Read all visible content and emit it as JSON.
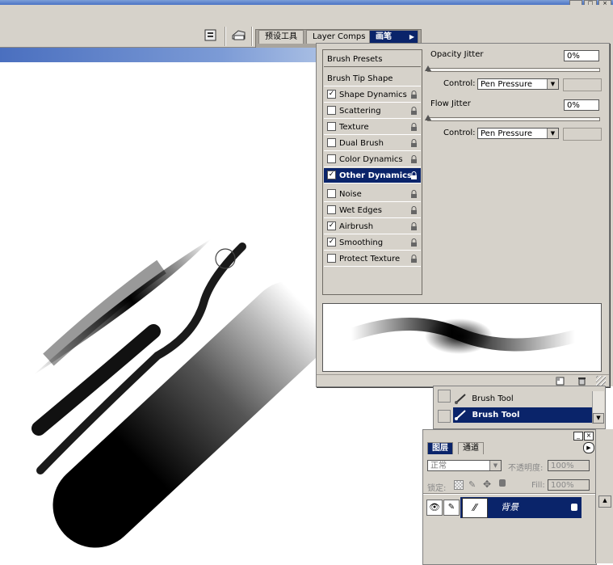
{
  "window": {
    "controls": [
      "_",
      "□",
      "×"
    ]
  },
  "toolbar": {
    "tabs": [
      {
        "label": "预设工具",
        "active": false
      },
      {
        "label": "Layer Comps",
        "active": false
      },
      {
        "label": "画笔",
        "active": true
      }
    ]
  },
  "brush_panel": {
    "presets_label": "Brush Presets",
    "tip_shape_label": "Brush Tip Shape",
    "items": [
      {
        "label": "Shape Dynamics",
        "checked": true
      },
      {
        "label": "Scattering",
        "checked": false
      },
      {
        "label": "Texture",
        "checked": false
      },
      {
        "label": "Dual Brush",
        "checked": false
      },
      {
        "label": "Color Dynamics",
        "checked": false
      },
      {
        "label": "Other Dynamics",
        "checked": true,
        "selected": true
      },
      {
        "label": "Noise",
        "checked": false
      },
      {
        "label": "Wet Edges",
        "checked": false
      },
      {
        "label": "Airbrush",
        "checked": true
      },
      {
        "label": "Smoothing",
        "checked": true
      },
      {
        "label": "Protect Texture",
        "checked": false
      }
    ],
    "opacity_jitter": {
      "label": "Opacity Jitter",
      "value": "0%",
      "control_label": "Control:",
      "control_value": "Pen Pressure"
    },
    "flow_jitter": {
      "label": "Flow Jitter",
      "value": "0%",
      "control_label": "Control:",
      "control_value": "Pen Pressure"
    }
  },
  "history": {
    "rows": [
      {
        "label": "Brush Tool",
        "selected": false
      },
      {
        "label": "Brush Tool",
        "selected": true
      }
    ]
  },
  "layers": {
    "tabs": [
      {
        "label": "图层",
        "active": true
      },
      {
        "label": "通道",
        "active": false
      }
    ],
    "blend_mode": "正常",
    "opacity_label": "不透明度:",
    "opacity_value": "100%",
    "lock_label": "锁定:",
    "fill_label": "Fill:",
    "fill_value": "100%",
    "layer_name": "背景"
  },
  "colors": {
    "panel_bg": "#d6d2ca",
    "selection": "#0a246a",
    "title_blue": "#4a72c4"
  }
}
